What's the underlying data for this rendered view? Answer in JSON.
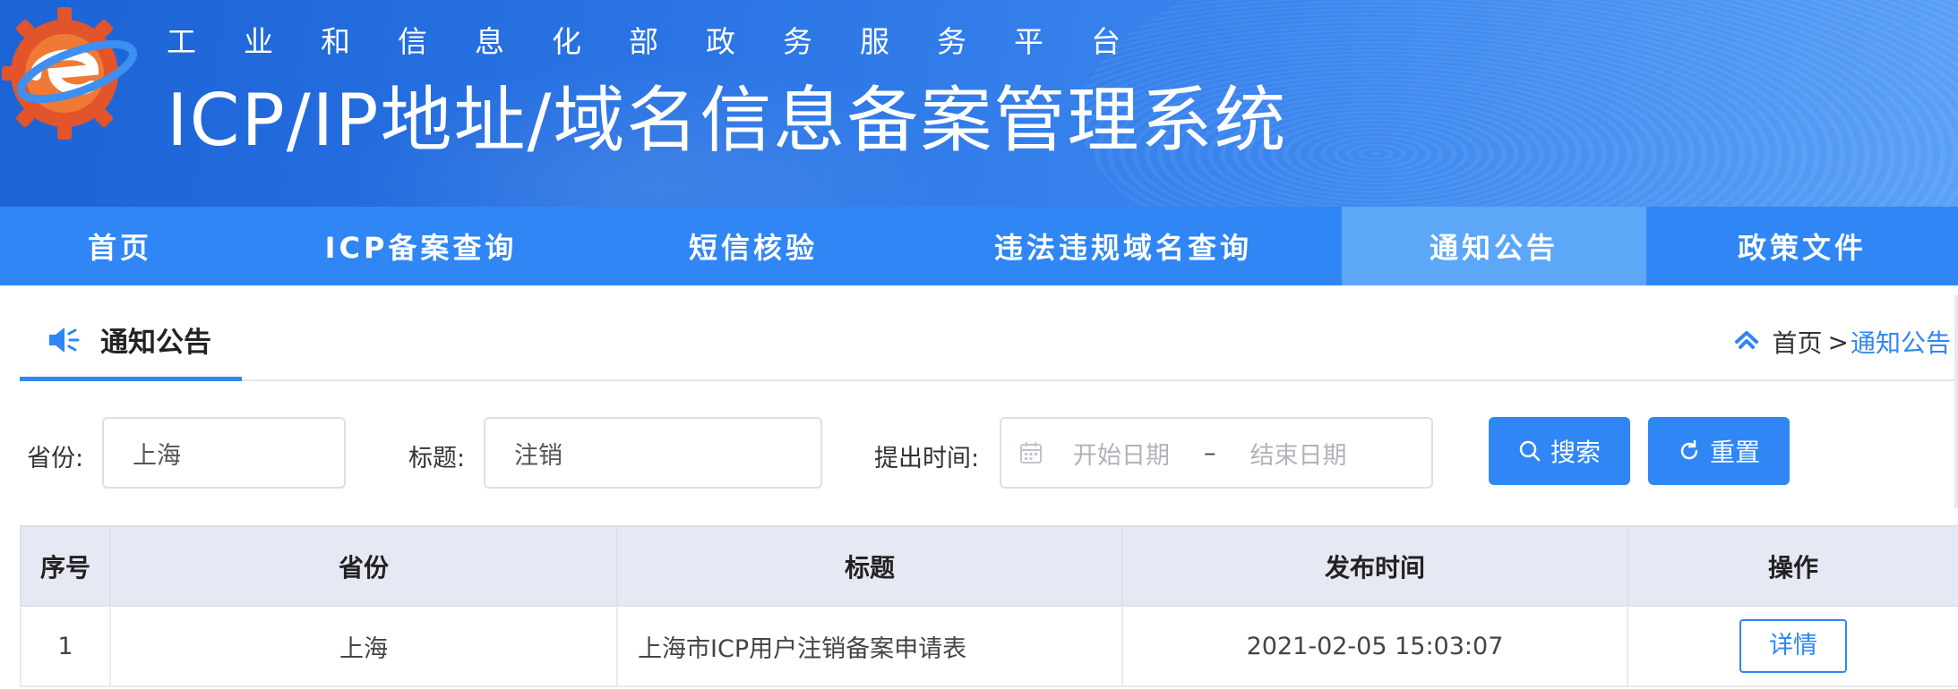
{
  "header": {
    "sub_title": "工业和信息化部政务服务平台",
    "main_title": "ICP/IP地址/域名信息备案管理系统"
  },
  "nav": {
    "items": [
      {
        "label": "首页"
      },
      {
        "label": "ICP备案查询"
      },
      {
        "label": "短信核验"
      },
      {
        "label": "违法违规域名查询"
      },
      {
        "label": "通知公告",
        "active": true
      },
      {
        "label": "政策文件"
      }
    ]
  },
  "section": {
    "title": "通知公告",
    "icon": "speaker-icon"
  },
  "breadcrumb": {
    "home": "首页",
    "separator": ">",
    "current": "通知公告"
  },
  "filters": {
    "province_label": "省份:",
    "province_value": "上海",
    "title_label": "标题:",
    "title_value": "注销",
    "time_label": "提出时间:",
    "start_placeholder": "开始日期",
    "range_separator": "–",
    "end_placeholder": "结束日期",
    "search_button": "搜索",
    "reset_button": "重置"
  },
  "table": {
    "columns": [
      "序号",
      "省份",
      "标题",
      "发布时间",
      "操作"
    ],
    "rows": [
      {
        "index": "1",
        "province": "上海",
        "title": "上海市ICP用户注销备案申请表",
        "published": "2021-02-05 15:03:07",
        "action": "详情"
      }
    ]
  },
  "colors": {
    "primary": "#2f86f4",
    "nav_active": "#5da7f8",
    "table_header_bg": "#e6e8f3"
  }
}
